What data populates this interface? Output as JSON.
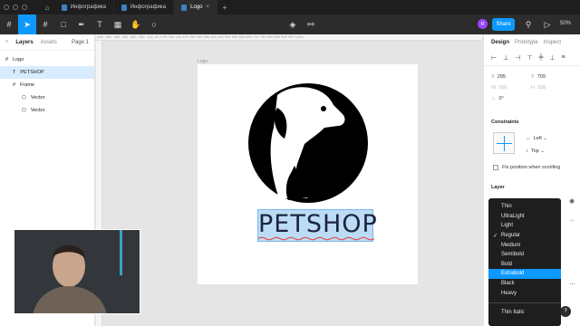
{
  "tabs": [
    {
      "label": "Инфографика"
    },
    {
      "label": "Инфографика"
    },
    {
      "label": "Logo"
    }
  ],
  "toolbar": {
    "share": "Share",
    "avatar": "R",
    "zoom": "50%"
  },
  "left": {
    "tab_layers": "Layers",
    "tab_assets": "Assets",
    "page": "Page 1",
    "layers": [
      {
        "name": "Logo"
      },
      {
        "name": "PETSHOP"
      },
      {
        "name": "Frame"
      },
      {
        "name": "Vector"
      },
      {
        "name": "Vector"
      }
    ]
  },
  "canvas": {
    "frame_label": "Logo",
    "logo_text": "PETSHOP",
    "ruler": "-400  -350  -300  -250  -200  -150  -100  -50  0  50  100  150  200  250  300  350  400  450  500  550  600  650  700  750  800  850  900  950  1000"
  },
  "right": {
    "tab_design": "Design",
    "tab_prototype": "Prototype",
    "tab_inspect": "Inspect",
    "x_label": "X",
    "x": "295",
    "y_label": "Y",
    "y": "709",
    "w_label": "W",
    "w": "566",
    "h_label": "H",
    "h": "158",
    "rot": "0°",
    "constraints": "Constraints",
    "h_constraint": "Left",
    "v_constraint": "Top",
    "fix": "Fix position when scrolling",
    "layer": "Layer"
  },
  "menu": {
    "items": [
      {
        "label": "Thin"
      },
      {
        "label": "UltraLight"
      },
      {
        "label": "Light"
      },
      {
        "label": "Regular"
      },
      {
        "label": "Medium"
      },
      {
        "label": "Semibold"
      },
      {
        "label": "Bold"
      },
      {
        "label": "Extrabold"
      },
      {
        "label": "Black"
      },
      {
        "label": "Heavy"
      },
      {
        "label": "Thin Italic"
      }
    ],
    "checked": "Regular",
    "highlighted": "Extrabold"
  },
  "colors": {
    "accent": "#0d99ff",
    "dark": "#1e1e1e",
    "logo_bg": "#000000",
    "text_select": "#bcdcf5"
  }
}
